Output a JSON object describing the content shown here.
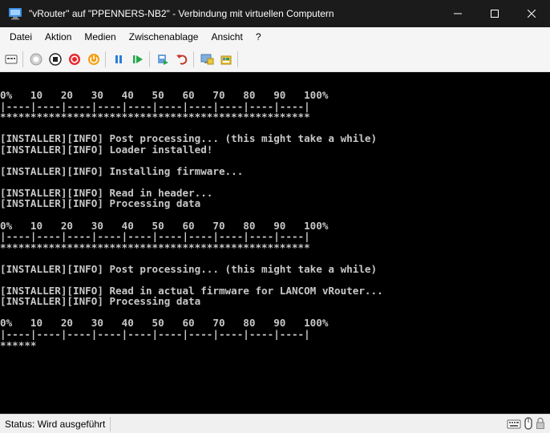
{
  "window": {
    "title": "\"vRouter\" auf \"PPENNERS-NB2\" - Verbindung mit virtuellen Computern",
    "minimize": "—",
    "maximize": "☐",
    "close": "✕"
  },
  "menu": {
    "items": [
      "Datei",
      "Aktion",
      "Medien",
      "Zwischenablage",
      "Ansicht",
      "?"
    ]
  },
  "toolbar": {
    "icons": [
      "ctrl-alt-del-icon",
      "start-icon",
      "turn-off-icon",
      "shutdown-icon",
      "save-icon",
      "pause-icon",
      "resume-icon",
      "checkpoint-icon",
      "revert-icon",
      "enhanced-session-icon",
      "share-icon"
    ]
  },
  "console": {
    "text": "0%   10   20   30   40   50   60   70   80   90   100%\n|----|----|----|----|----|----|----|----|----|----|\n***************************************************\n\n[INSTALLER][INFO] Post processing... (this might take a while)\n[INSTALLER][INFO] Loader installed!\n\n[INSTALLER][INFO] Installing firmware...\n\n[INSTALLER][INFO] Read in header...\n[INSTALLER][INFO] Processing data\n\n0%   10   20   30   40   50   60   70   80   90   100%\n|----|----|----|----|----|----|----|----|----|----|\n***************************************************\n\n[INSTALLER][INFO] Post processing... (this might take a while)\n\n[INSTALLER][INFO] Read in actual firmware for LANCOM vRouter...\n[INSTALLER][INFO] Processing data\n\n0%   10   20   30   40   50   60   70   80   90   100%\n|----|----|----|----|----|----|----|----|----|----|\n******"
  },
  "status": {
    "text": "Status: Wird ausgeführt",
    "icons": [
      "keyboard-icon",
      "mouse-icon",
      "lock-icon"
    ]
  },
  "colors": {
    "titlebar": "#1b1b1b",
    "menubar": "#f5f5f5",
    "console_bg": "#000000",
    "console_fg": "#c8c8c8"
  }
}
